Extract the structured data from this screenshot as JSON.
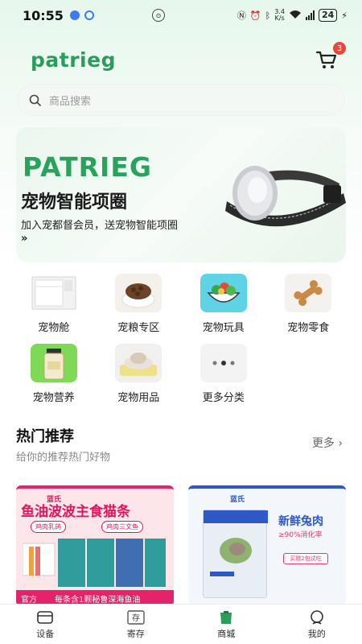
{
  "status_bar": {
    "time": "10:55",
    "net_speed_value": "3.4",
    "net_speed_unit": "K/s",
    "battery": "24"
  },
  "header": {
    "logo": "patrieg",
    "cart_badge": "3"
  },
  "search": {
    "placeholder": "商品搜索"
  },
  "banner": {
    "brand": "PATRIEG",
    "title": "宠物智能项圈",
    "subtitle": "加入宠都督会员，送宠物智能项圈",
    "arrow": "»"
  },
  "categories": [
    {
      "label": "宠物舱",
      "icon": "pet-cabin"
    },
    {
      "label": "宠粮专区",
      "icon": "pet-food"
    },
    {
      "label": "宠物玩具",
      "icon": "pet-toy"
    },
    {
      "label": "宠物零食",
      "icon": "pet-snack"
    },
    {
      "label": "宠物营养",
      "icon": "pet-nutrition"
    },
    {
      "label": "宠物用品",
      "icon": "pet-supplies"
    },
    {
      "label": "更多分类",
      "icon": "more-dots"
    }
  ],
  "hot": {
    "title": "热门推荐",
    "subtitle": "给你的推荐热门好物",
    "more": "更多"
  },
  "products": [
    {
      "brand": "蓝氏",
      "title": "鱼油波波主食猫条",
      "tag1": "鸡肉乳鸽",
      "tag2": "鸡肉三文鱼",
      "bottom_left": "官方",
      "bottom_text": "每条含1颗秘鲁深海鱼油",
      "colors": {
        "accent": "#e4246a",
        "bg": "#fce6ea"
      }
    },
    {
      "brand": "蓝氏",
      "title": "新鲜兔肉",
      "subtitle": "≥90%消化率",
      "box": "买赠2包试吃",
      "colors": {
        "accent": "#2d59c7",
        "bg": "#f3f6fb"
      }
    }
  ],
  "tabbar": [
    {
      "label": "设备",
      "icon": "device-icon"
    },
    {
      "label": "寄存",
      "icon": "storage-icon"
    },
    {
      "label": "商城",
      "icon": "mall-icon",
      "active": true
    },
    {
      "label": "我的",
      "icon": "profile-icon"
    }
  ],
  "colors": {
    "brand_green": "#2a9d5c",
    "badge_red": "#e8463a"
  }
}
